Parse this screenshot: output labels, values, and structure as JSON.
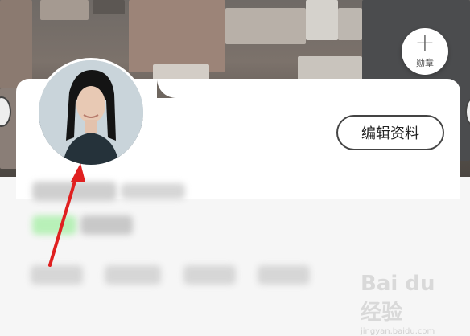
{
  "header": {
    "medal_button": {
      "icon": "plus-icon",
      "label": "勋章"
    }
  },
  "profile": {
    "avatar": "avatar-photo",
    "edit_button_label": "编辑资料"
  },
  "watermark": {
    "logo_text": "Bai du 经验",
    "sub_text": "jingyan.baidu.com"
  },
  "colors": {
    "annotation_arrow": "#e02020"
  }
}
